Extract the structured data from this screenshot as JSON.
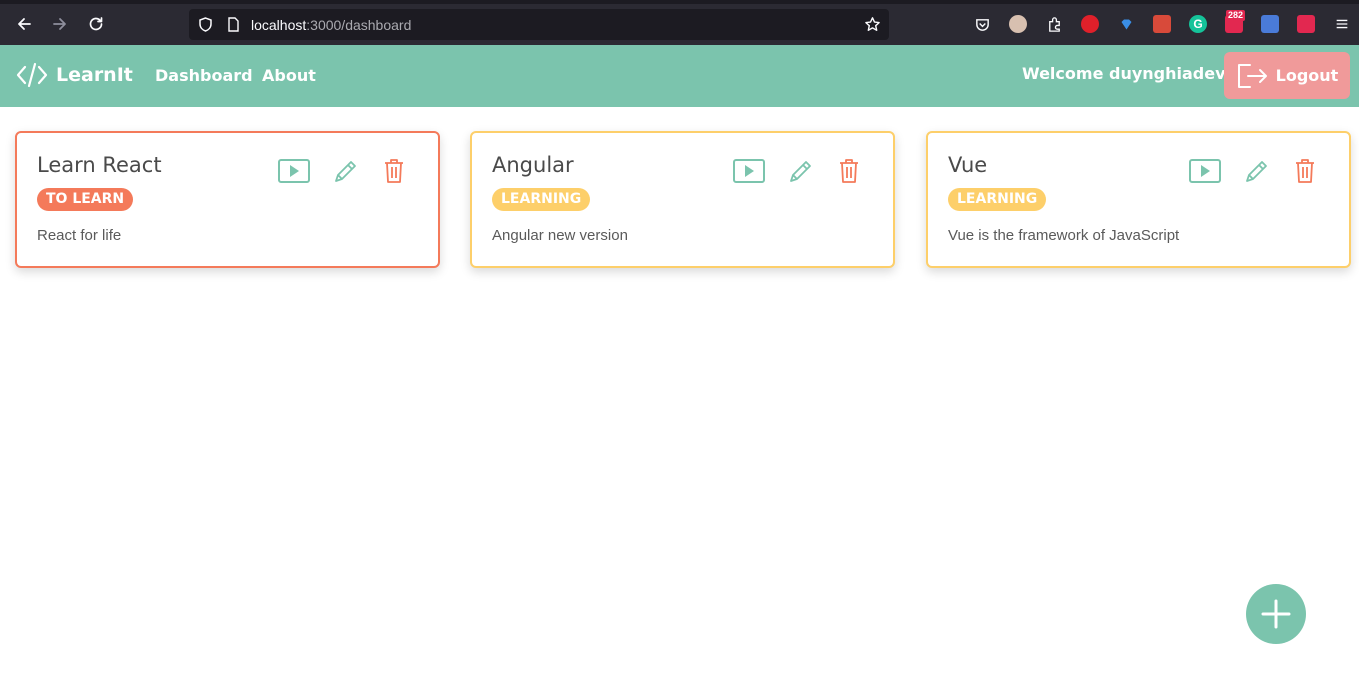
{
  "browser": {
    "url_host": "localhost",
    "url_path": ":3000/dashboard",
    "notification_count": "282"
  },
  "navbar": {
    "brand": "LearnIt",
    "links": [
      {
        "label": "Dashboard"
      },
      {
        "label": "About"
      }
    ],
    "welcome": "Welcome duynghiadev",
    "logout_label": "Logout"
  },
  "colors": {
    "primary": "#7bc4ad",
    "to_learn": "#f47a5a",
    "learning": "#fdcf6a",
    "danger": "#f47a5a",
    "logout_bg": "#f09a9a"
  },
  "posts": [
    {
      "title": "Learn React",
      "status": "TO LEARN",
      "description": "React for life"
    },
    {
      "title": "Angular",
      "status": "LEARNING",
      "description": "Angular new version"
    },
    {
      "title": "Vue",
      "status": "LEARNING",
      "description": "Vue is the framework of JavaScript"
    }
  ]
}
